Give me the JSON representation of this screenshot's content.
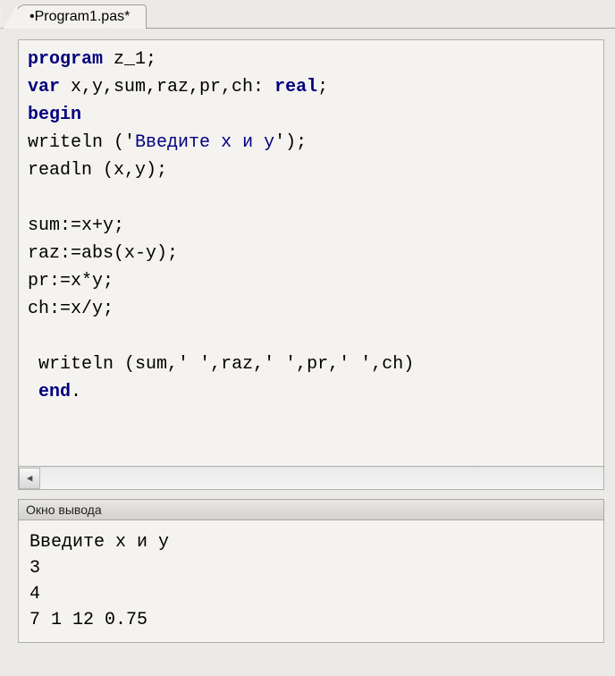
{
  "tab": {
    "label": "•Program1.pas*"
  },
  "code": {
    "line1": {
      "kw1": "program",
      "rest": " z_1;"
    },
    "line2": {
      "kw1": "var",
      "ids": " x,y,sum,raz,pr,ch: ",
      "kw2": "real",
      "end": ";"
    },
    "line3": {
      "kw1": "begin"
    },
    "line4": {
      "call": "writeln",
      "open": " (",
      "q1": "'",
      "str": "Введите x и y",
      "q2": "'",
      "close": ");"
    },
    "line5": {
      "text": "readln (x,y);"
    },
    "line6": {
      "text": ""
    },
    "line7": {
      "text": "sum:=x+y;"
    },
    "line8": {
      "text": "raz:=abs(x-y);"
    },
    "line9": {
      "text": "pr:=x*y;"
    },
    "line10": {
      "text": "ch:=x/y;"
    },
    "line11": {
      "text": ""
    },
    "line12a": {
      "text": " writeln (sum,"
    },
    "line12b": {
      "q1": "'",
      "sp": " ",
      "q2": "'"
    },
    "line12c": {
      "text": ",raz,"
    },
    "line12d": {
      "q1": "'",
      "sp": " ",
      "q2": "'"
    },
    "line12e": {
      "text": ",pr,"
    },
    "line12f": {
      "q1": "'",
      "sp": " ",
      "q2": "'"
    },
    "line12g": {
      "text": ",ch)"
    },
    "line13": {
      "pre": " ",
      "kw": "end",
      "post": "."
    }
  },
  "scroll": {
    "left_glyph": "◀"
  },
  "output": {
    "title": "Окно вывода",
    "line1": "Введите x и y",
    "line2": "3",
    "line3": "4",
    "line4": "7 1 12 0.75"
  }
}
